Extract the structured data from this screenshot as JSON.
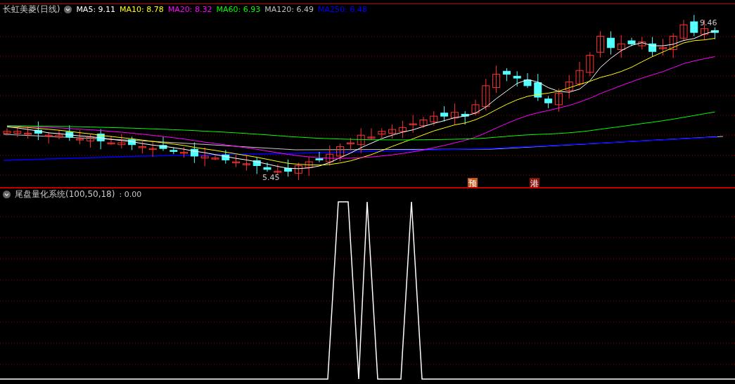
{
  "main_pane": {
    "title": "长虹美菱(日线)",
    "indicators": [
      {
        "label": "MA5: 9.11",
        "color": "#ffffff"
      },
      {
        "label": "MA10: 8.78",
        "color": "#ffff00"
      },
      {
        "label": "MA20: 8.32",
        "color": "#ff00ff"
      },
      {
        "label": "MA60: 6.93",
        "color": "#00ff00"
      },
      {
        "label": "MA120: 6.49",
        "color": "#c0c0c0"
      },
      {
        "label": "MA250: 6.48",
        "color": "#0000ff"
      }
    ],
    "high_label": "9.46",
    "low_label": "5.45",
    "markers": [
      {
        "label": "预",
        "color": "#c8561a"
      },
      {
        "label": "港",
        "color": "#8a1408"
      }
    ]
  },
  "indicator_pane": {
    "title": "尾盘量化系统(100,50,18)",
    "value": ": 0.00"
  }
}
